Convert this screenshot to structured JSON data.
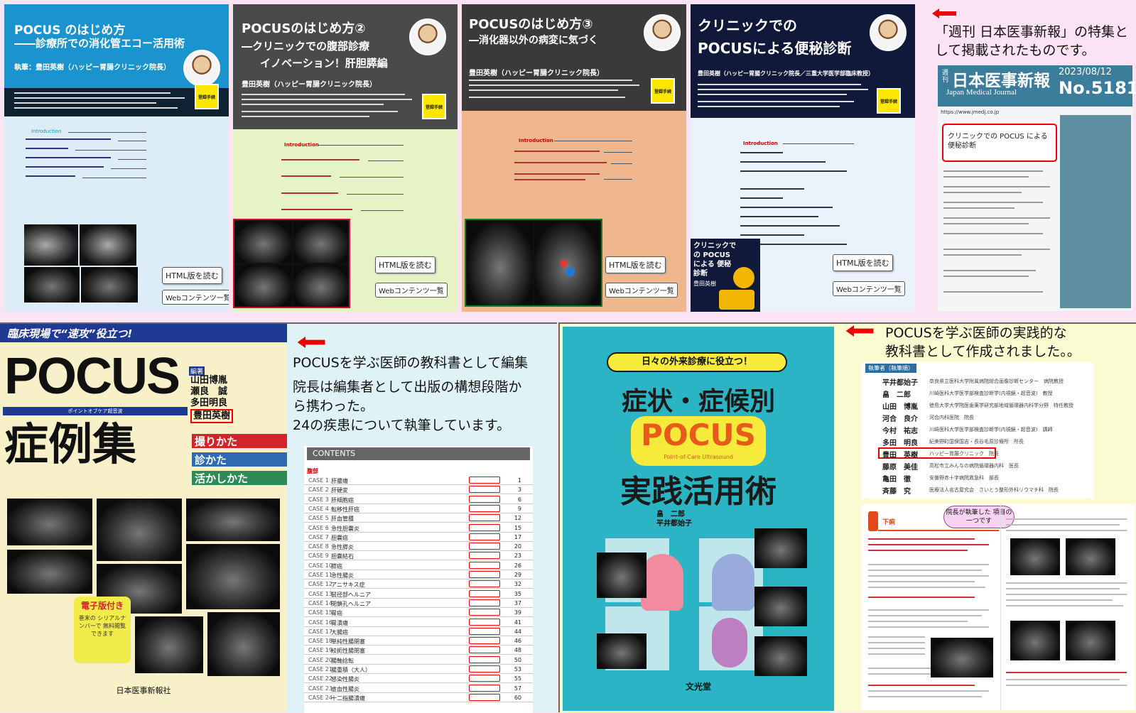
{
  "covers": [
    {
      "title1": "POCUS のはじめ方",
      "title2": "――診療所での消化管エコー活用術",
      "author": "執筆：豊田英樹（ハッピー胃腸クリニック院長）",
      "html_btn": "HTML版を読む",
      "web_btn": "Webコンテンツ一覧",
      "reg": "登録手続",
      "toc_intro": "Introduction"
    },
    {
      "title1": "POCUSのはじめ方②",
      "title2": "―クリニックでの腹部診療",
      "title3": "イノベーション！肝胆膵編",
      "author": "豊田英樹（ハッピー胃腸クリニック院長）",
      "html_btn": "HTML版を読む",
      "web_btn": "Webコンテンツ一覧",
      "reg": "登録手続",
      "toc_intro": "Introduction"
    },
    {
      "title1": "POCUSのはじめ方③",
      "title2": "―消化器以外の病変に気づく",
      "author": "豊田英樹（ハッピー胃腸クリニック院長）",
      "html_btn": "HTML版を読む",
      "web_btn": "Webコンテンツ一覧",
      "reg": "登録手続",
      "toc_intro": "Introduction"
    },
    {
      "title1": "クリニックでの",
      "title2": "POCUSによる便秘診断",
      "author": "豊田英樹（ハッピー胃腸クリニック院長／三重大学医学部臨床教授）",
      "html_btn": "HTML版を読む",
      "web_btn": "Webコンテンツ一覧",
      "reg": "登録手続",
      "toc_intro": "Introduction",
      "book_title": "クリニックでの POCUS による 便秘診断",
      "book_author": "豊田英樹"
    }
  ],
  "jmj": {
    "caption1": "「週刊 日本医事新報」の特集と",
    "caption2": "して掲載されたものです。",
    "weekly": "週刊",
    "name_ja": "日本医事新報",
    "name_en": "Japan Medical Journal",
    "date": "2023/08/12",
    "number": "No.5181",
    "url": "https://www.jmedj.co.jp",
    "feature": "クリニックでの POCUS による便秘診断"
  },
  "pocus_book": {
    "banner": "臨床現場で“速攻”役立つ!",
    "title": "POCUS",
    "subtitle": "症例集",
    "ribbon": "ポイントオブケア超音波",
    "editors_label": "編著",
    "editors": [
      "山田博胤",
      "瀬良　誠",
      "多田明良",
      "豊田英樹"
    ],
    "tabs": [
      "撮りかた",
      "診かた",
      "活かしかた"
    ],
    "ebook": "電子版付き",
    "ebook_note": "巻末の シリアルナンバーで 無料閲覧できます",
    "publisher": "日本医事新報社",
    "caption": [
      "POCUSを学ぶ医師の教科書として編集",
      "院長は編集者として出版の構想段階か",
      "ら携わった。",
      "24の疾患について執筆しています。"
    ],
    "contents_header": "CONTENTS",
    "contents_section": "腹部",
    "cases": [
      {
        "no": "CASE 1",
        "name": "肝膿瘍",
        "page": "1"
      },
      {
        "no": "CASE 2",
        "name": "肝硬変",
        "page": "3"
      },
      {
        "no": "CASE 3",
        "name": "肝細胞癌",
        "page": "6"
      },
      {
        "no": "CASE 4",
        "name": "転移性肝癌",
        "page": "9"
      },
      {
        "no": "CASE 5",
        "name": "肝血管腫",
        "page": "12"
      },
      {
        "no": "CASE 6",
        "name": "急性胆嚢炎",
        "page": "15"
      },
      {
        "no": "CASE 7",
        "name": "胆嚢癌",
        "page": "17"
      },
      {
        "no": "CASE 8",
        "name": "急性膵炎",
        "page": "20"
      },
      {
        "no": "CASE 9",
        "name": "胆嚢結石",
        "page": "23"
      },
      {
        "no": "CASE 10",
        "name": "膵癌",
        "page": "26"
      },
      {
        "no": "CASE 11",
        "name": "急性腸炎",
        "page": "29"
      },
      {
        "no": "CASE 12",
        "name": "アニサキス症",
        "page": "32"
      },
      {
        "no": "CASE 13",
        "name": "鼠径部ヘルニア",
        "page": "35"
      },
      {
        "no": "CASE 14",
        "name": "閉鎖孔ヘルニア",
        "page": "37"
      },
      {
        "no": "CASE 15",
        "name": "胃癌",
        "page": "39"
      },
      {
        "no": "CASE 16",
        "name": "胃潰瘍",
        "page": "41"
      },
      {
        "no": "CASE 17",
        "name": "大腸癌",
        "page": "44"
      },
      {
        "no": "CASE 18",
        "name": "単純性腸閉塞",
        "page": "46"
      },
      {
        "no": "CASE 19",
        "name": "絞扼性腸閉塞",
        "page": "48"
      },
      {
        "no": "CASE 20",
        "name": "腸軸捻転",
        "page": "50"
      },
      {
        "no": "CASE 21",
        "name": "腸重積（大人）",
        "page": "53"
      },
      {
        "no": "CASE 22",
        "name": "感染性腸炎",
        "page": "55"
      },
      {
        "no": "CASE 23",
        "name": "虚血性腸炎",
        "page": "57"
      },
      {
        "no": "CASE 24",
        "name": "十二指腸潰瘍",
        "page": "60"
      }
    ]
  },
  "jissen_book": {
    "banner": "日々の外来診療に役立つ！",
    "title1": "症状・症候別",
    "title2": "POCUS",
    "title2_sub": "Point-of-Care Ultrasound",
    "title3": "実践活用術",
    "authors": [
      "畠　二郎",
      "平井都始子"
    ],
    "publisher": "文光堂",
    "caption": [
      "POCUSを学ぶ医師の実践的な",
      "教科書として作成されました。。"
    ],
    "authors_label": "執筆者（執筆順）",
    "author_list": [
      {
        "name": "平井都始子",
        "aff": "奈良県立医科大学附属病院総合画像診断センター　病院教授"
      },
      {
        "name": "畠　二郎",
        "aff": "川崎医科大学医学部検査診断学(内視鏡・超音波)　教授"
      },
      {
        "name": "山田　博胤",
        "aff": "徳島大学大学院医歯薬学研究部地域循環器内科学分野　特任教授"
      },
      {
        "name": "河合　良介",
        "aff": "河合内科医院　院長"
      },
      {
        "name": "今村　祐志",
        "aff": "川崎医科大学医学部検査診断学(内視鏡・超音波)　講師"
      },
      {
        "name": "多田　明良",
        "aff": "紀美野町国保国吉・長谷毛原診療所　所長"
      },
      {
        "name": "豊田　英樹",
        "aff": "ハッピー胃腸クリニック　院長"
      },
      {
        "name": "藤原　美佳",
        "aff": "高松市立みんなの病院循環器内科　医長"
      },
      {
        "name": "亀田　徹",
        "aff": "安曇野赤十字病院救急科　部長"
      },
      {
        "name": "斉藤　究",
        "aff": "医療法人名古屋究会　さいとう整形外科リウマチ科　院長"
      }
    ],
    "bubble": "院長が執筆した 項目の一つです",
    "page_heading": "下痢"
  }
}
